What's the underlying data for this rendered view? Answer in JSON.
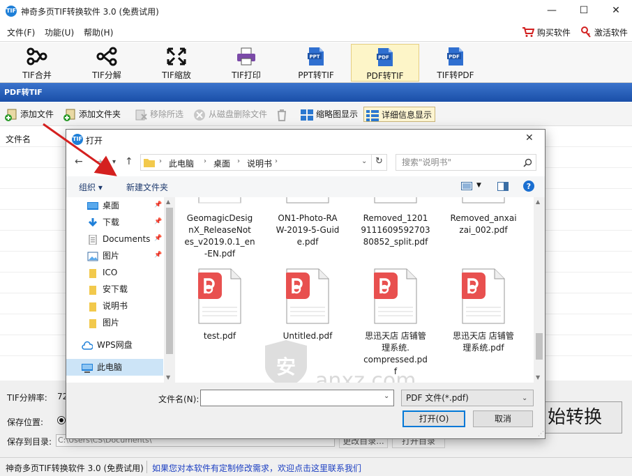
{
  "window": {
    "title": "神奇多页TIF转换软件 3.0 (免费试用)",
    "icon_text": "TIF",
    "controls": [
      "—",
      "☐",
      "✕"
    ]
  },
  "menu": {
    "items": [
      "文件(F)",
      "功能(U)",
      "帮助(H)"
    ],
    "buy": "购买软件",
    "activate": "激活软件"
  },
  "toolbar": {
    "tools": [
      {
        "label": "TIF合并",
        "icon": "merge-icon"
      },
      {
        "label": "TIF分解",
        "icon": "split-icon"
      },
      {
        "label": "TIF缩放",
        "icon": "resize-icon"
      },
      {
        "label": "TIF打印",
        "icon": "printer-icon"
      },
      {
        "label": "PPT转TIF",
        "icon": "ppt-file-icon"
      },
      {
        "label": "PDF转TIF",
        "icon": "pdf-file-icon",
        "active": true
      },
      {
        "label": "TIF转PDF",
        "icon": "pdf-file-icon"
      }
    ],
    "file_badges": {
      "ppt": "PPT",
      "pdf": "PDF"
    }
  },
  "section": {
    "title": "PDF转TIF"
  },
  "subtoolbar": {
    "add_file": "添加文件",
    "add_folder": "添加文件夹",
    "remove_selected": "移除所选",
    "delete_from_disk": "从磁盘删除文件",
    "thumbnail_view": "缩略图显示",
    "detail_view": "详细信息显示"
  },
  "list": {
    "column_filename": "文件名"
  },
  "settings": {
    "resolution_label": "TIF分辨率:",
    "resolution_value": "72",
    "save_location_label": "保存位置:",
    "save_dir_label": "保存到目录:",
    "save_dir_value": "C:\\Users\\CS\\Documents\\",
    "change_dir": "更改目录...",
    "open_dir": "打开目录",
    "start_button": "开始转换",
    "start_button_visible": "始转换"
  },
  "status": {
    "app_name": "神奇多页TIF转换软件 3.0 (免费试用)",
    "link": "如果您对本软件有定制修改需求，欢迎点击这里联系我们"
  },
  "dialog": {
    "title": "打开",
    "breadcrumb": [
      "此电脑",
      "桌面",
      "说明书"
    ],
    "search_placeholder": "搜索\"说明书\"",
    "organize": "组织 ▾",
    "new_folder": "新建文件夹",
    "nav_items": [
      {
        "label": "桌面",
        "icon": "desktop-icon",
        "pinned": true
      },
      {
        "label": "下载",
        "icon": "download-icon",
        "pinned": true
      },
      {
        "label": "Documents",
        "icon": "documents-icon",
        "pinned": true
      },
      {
        "label": "图片",
        "icon": "pictures-icon",
        "pinned": true
      },
      {
        "label": "ICO",
        "icon": "folder-icon",
        "pinned": false
      },
      {
        "label": "安下载",
        "icon": "folder-icon",
        "pinned": false
      },
      {
        "label": "说明书",
        "icon": "folder-icon",
        "pinned": false
      },
      {
        "label": "图片",
        "icon": "folder-icon",
        "pinned": false
      },
      {
        "label": "WPS网盘",
        "icon": "cloud-icon",
        "pinned": false
      },
      {
        "label": "此电脑",
        "icon": "computer-icon",
        "pinned": false,
        "selected": true
      }
    ],
    "files_row1": [
      "GeomagicDesignX_ReleaseNotes_v2019.0.1_en-EN.pdf",
      "ON1-Photo-RAW-2019-5-Guide.pdf",
      "Removed_12019111609592703 80852_split.pdf",
      "Removed_anxaizai_002.pdf"
    ],
    "files_row1_lines": [
      [
        "GeomagicDesig",
        "nX_ReleaseNot",
        "es_v2019.0.1_en",
        "-EN.pdf"
      ],
      [
        "ON1-Photo-RA",
        "W-2019-5-Guid",
        "e.pdf"
      ],
      [
        "Removed_1201",
        "9111609592703",
        "80852_split.pdf"
      ],
      [
        "Removed_anxai",
        "zai_002.pdf"
      ]
    ],
    "files_row2": [
      {
        "name": "test.pdf",
        "lines": [
          "test.pdf"
        ]
      },
      {
        "name": "Untitled.pdf",
        "lines": [
          "Untitled.pdf"
        ]
      },
      {
        "name": "思迅天店 店铺管理系统.compressed.pdf",
        "lines": [
          "思迅天店 店铺管",
          "理系统.",
          "compressed.pd",
          "f"
        ]
      },
      {
        "name": "思迅天店 店铺管理系统.pdf",
        "lines": [
          "思迅天店 店铺管",
          "理系统.pdf"
        ]
      }
    ],
    "filename_label": "文件名(N):",
    "filename_value": "",
    "filter": "PDF 文件(*.pdf)",
    "open_button": "打开(O)",
    "cancel_button": "取消"
  },
  "watermark": {
    "text": "anxz.com"
  },
  "colors": {
    "section_bar": "#1a4fa8",
    "active_tool": "#fdf5c8",
    "pdf_red": "#e8504f",
    "dialog_accent": "#0078d7",
    "arrow": "#d4201f",
    "link": "#1c3fc2"
  }
}
